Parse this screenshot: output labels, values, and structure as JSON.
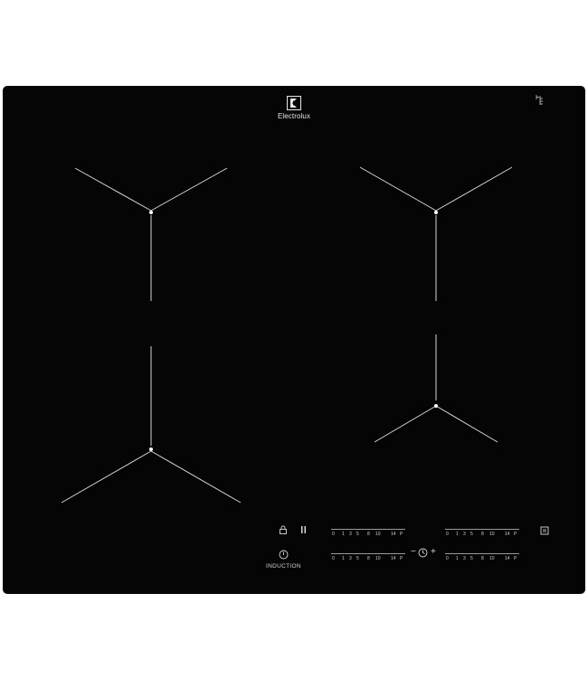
{
  "product": {
    "brand_name": "Electrolux",
    "induction_label": "INDUCTION",
    "surface_color": "#050505",
    "marking_color": "#d8d8d8"
  },
  "icons": {
    "brand_logo": "electrolux-logo-icon",
    "corner": "sensor-symbol-icon",
    "lock": "lock-icon",
    "pause": "pause-icon",
    "power": "power-icon",
    "timer": "timer-icon",
    "timer_minus": "minus-icon",
    "timer_plus": "plus-icon",
    "hob2hood": "hood-icon"
  },
  "power_scale": {
    "labels": [
      "0",
      "1",
      "3",
      "5",
      "8",
      "10",
      "14",
      "P"
    ]
  },
  "controls": {
    "timer_minus_label": "−",
    "timer_plus_label": "+"
  }
}
